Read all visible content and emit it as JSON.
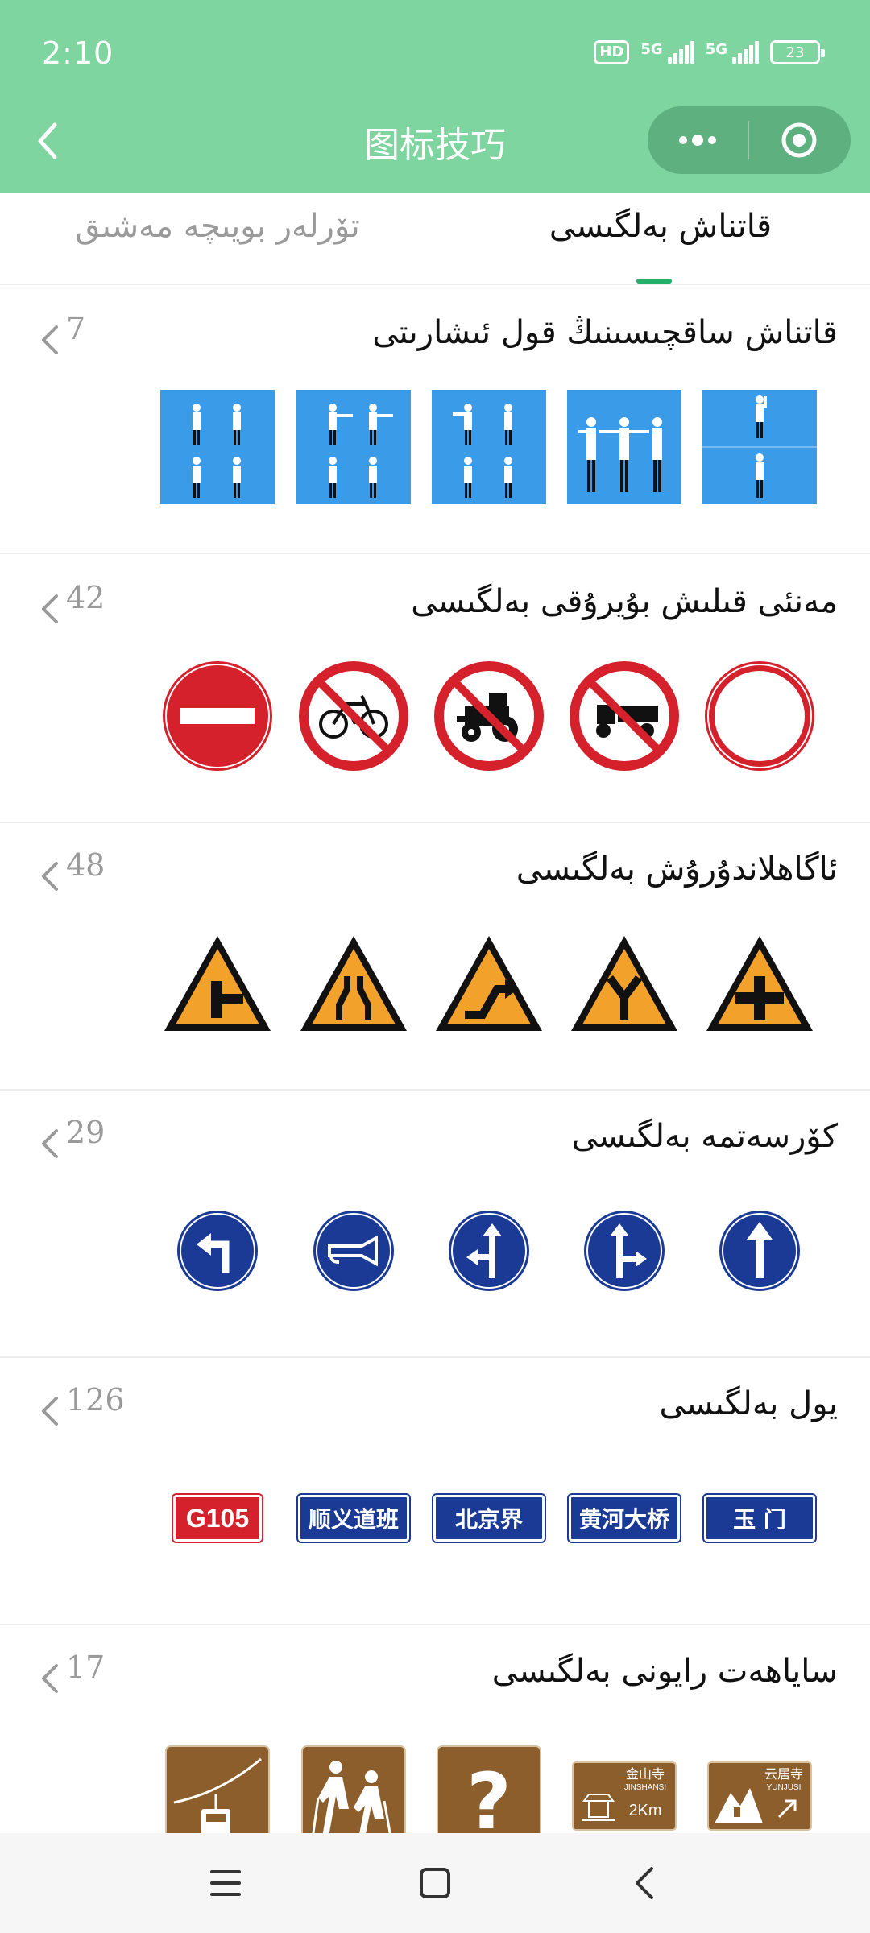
{
  "status_bar": {
    "time": "2:10",
    "hd": "HD",
    "sim1": "5G",
    "sim2": "5G",
    "battery": "23"
  },
  "header": {
    "title": "图标技巧"
  },
  "tabs": [
    {
      "label": "تۆرلەر بويىچە مەشىق",
      "active": false
    },
    {
      "label": "قاتناش بەلگىسى",
      "active": true
    }
  ],
  "sections": [
    {
      "title": "قاتناش ساقچىسىنىڭ قول ئىشارىتى",
      "count": "7",
      "icon_names": [
        "police-gesture-1",
        "police-gesture-2",
        "police-gesture-3",
        "police-gesture-4",
        "police-gesture-5"
      ]
    },
    {
      "title": "مەنئى قىلىش بۇيرۇقى بەلگىسى",
      "count": "42",
      "icon_names": [
        "no-entry-sign",
        "no-bicycle-sign",
        "no-tractor-sign",
        "no-tricycle-sign",
        "no-vehicles-sign"
      ]
    },
    {
      "title": "ئاگاھلاندۇرۇش بەلگىسى",
      "count": "48",
      "icon_names": [
        "side-road-warning",
        "road-narrows-warning",
        "double-bend-warning",
        "y-junction-warning",
        "crossroads-warning"
      ]
    },
    {
      "title": "كۆرسەتمە بەلگىسى",
      "count": "29",
      "icon_names": [
        "turn-left-sign",
        "horn-sign",
        "straight-or-left-sign",
        "straight-or-right-sign",
        "straight-ahead-sign"
      ]
    },
    {
      "title": "يول بەلگىسى",
      "count": "126",
      "signs": [
        "G105",
        "顺义道班",
        "北京界",
        "黄河大桥",
        "玉  门"
      ]
    },
    {
      "title": "سایاھەت رايونى بەلگىسى",
      "count": "17",
      "tourist": {
        "jinshan": "金山寺",
        "jinshan_py": "JINSHANSI",
        "jinshan_dist": "2Km",
        "yunju": "云居寺",
        "yunju_py": "YUNJUSI",
        "question": "?"
      }
    }
  ],
  "colors": {
    "header_green": "#7fd59f",
    "tab_accent": "#22b06a",
    "prohibit_red": "#d4212b",
    "warning_orange": "#f2a22b",
    "guide_blue": "#1a3a95",
    "tourist_brown": "#8b5e2b",
    "police_blue": "#3a9be8"
  }
}
